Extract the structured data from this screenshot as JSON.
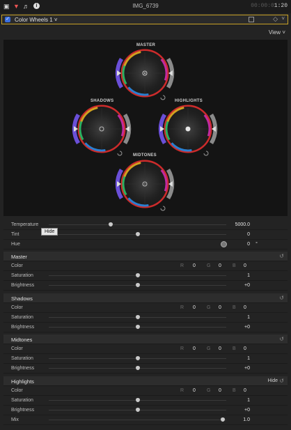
{
  "topbar": {
    "clip_name": "IMG_6739",
    "timecode_dim": "00:00:0",
    "timecode_bright": "1:20",
    "icons": [
      "film-icon",
      "color-inspector-icon",
      "audio-icon",
      "info-icon"
    ]
  },
  "effect": {
    "name": "Color Wheels 1",
    "view_label": "View"
  },
  "wheels": {
    "master_label": "MASTER",
    "shadows_label": "SHADOWS",
    "highlights_label": "HIGHLIGHTS",
    "midtones_label": "MIDTONES"
  },
  "global": {
    "temperature": {
      "label": "Temperature",
      "value": "5000.0",
      "pos": 0.35
    },
    "tint": {
      "label": "Tint",
      "value": "0",
      "pos": 0.5
    },
    "hue": {
      "label": "Hue",
      "value": "0",
      "unit": "°"
    }
  },
  "tooltip": "Hide",
  "channel_labels": {
    "r": "R",
    "g": "G",
    "b": "B"
  },
  "sections": {
    "master": {
      "title": "Master",
      "color_label": "Color",
      "r": "0",
      "g": "0",
      "b": "0",
      "saturation_label": "Saturation",
      "saturation": "1",
      "saturation_pos": 0.5,
      "brightness_label": "Brightness",
      "brightness": "+0",
      "brightness_pos": 0.5
    },
    "shadows": {
      "title": "Shadows",
      "color_label": "Color",
      "r": "0",
      "g": "0",
      "b": "0",
      "saturation_label": "Saturation",
      "saturation": "1",
      "saturation_pos": 0.5,
      "brightness_label": "Brightness",
      "brightness": "+0",
      "brightness_pos": 0.5
    },
    "midtones": {
      "title": "Midtones",
      "color_label": "Color",
      "r": "0",
      "g": "0",
      "b": "0",
      "saturation_label": "Saturation",
      "saturation": "1",
      "saturation_pos": 0.5,
      "brightness_label": "Brightness",
      "brightness": "+0",
      "brightness_pos": 0.5
    },
    "highlights": {
      "title": "Highlights",
      "hide_label": "Hide",
      "color_label": "Color",
      "r": "0",
      "g": "0",
      "b": "0",
      "saturation_label": "Saturation",
      "saturation": "1",
      "saturation_pos": 0.5,
      "brightness_label": "Brightness",
      "brightness": "+0",
      "brightness_pos": 0.5,
      "mix_label": "Mix",
      "mix": "1.0",
      "mix_pos": 0.98
    }
  },
  "colors": {
    "accent_border": "#c9a227",
    "checkbox": "#3b6fe0",
    "wheel_purple": "#6a4fd8"
  }
}
